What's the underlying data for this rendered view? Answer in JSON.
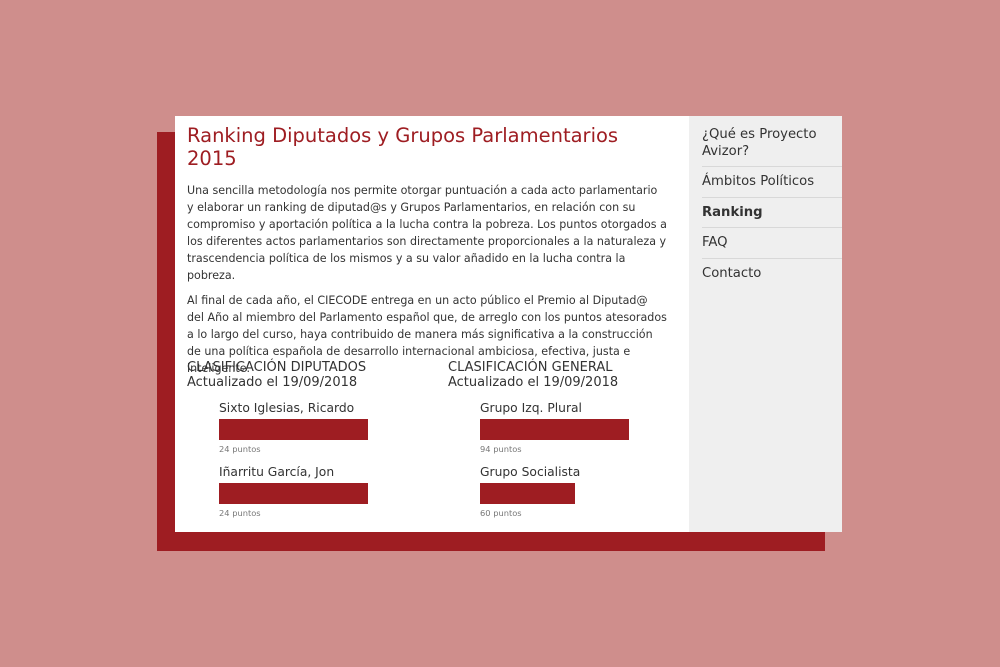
{
  "page": {
    "title": "Ranking Diputados y Grupos Parlamentarios 2015",
    "paragraphs": [
      "Una sencilla metodología nos permite otorgar puntuación a cada acto parlamentario y elaborar un ranking de diputad@s y Grupos Parlamentarios, en relación con su compromiso y aportación política a la lucha contra la pobreza. Los puntos otorgados a los diferentes actos parlamentarios son directamente proporcionales a la naturaleza y trascendencia política de los mismos y a su valor añadido en la lucha contra la pobreza.",
      "Al final de cada año, el CIECODE entrega en un acto público el Premio al Diputad@ del Año al miembro del Parlamento español que, de arreglo con los puntos atesorados a lo largo del curso, haya contribuido de manera más significativa a la construcción de una política española de desarrollo internacional ambiciosa, efectiva, justa e inteligente."
    ]
  },
  "ranking_deputies": {
    "heading": "CLASIFICACIÓN DIPUTADOS",
    "updated": "Actualizado el 19/09/2018",
    "items": [
      {
        "name": "Sixto Iglesias, Ricardo",
        "points": 24,
        "points_label": "24 puntos"
      },
      {
        "name": "Iñarritu García, Jon",
        "points": 24,
        "points_label": "24 puntos"
      }
    ]
  },
  "ranking_general": {
    "heading": "CLASIFICACIÓN GENERAL",
    "updated": "Actualizado el 19/09/2018",
    "items": [
      {
        "name": "Grupo Izq. Plural",
        "points": 94,
        "points_label": "94 puntos"
      },
      {
        "name": "Grupo Socialista",
        "points": 60,
        "points_label": "60 puntos"
      }
    ]
  },
  "sidebar": {
    "items": [
      {
        "label": "¿Qué es Proyecto Avizor?"
      },
      {
        "label": "Ámbitos Políticos"
      },
      {
        "label": "Ranking",
        "active": true
      },
      {
        "label": "FAQ"
      },
      {
        "label": "Contacto"
      }
    ]
  },
  "colors": {
    "accent": "#9e1d22",
    "background": "#cf8e8c",
    "sidebar_bg": "#efefef"
  }
}
